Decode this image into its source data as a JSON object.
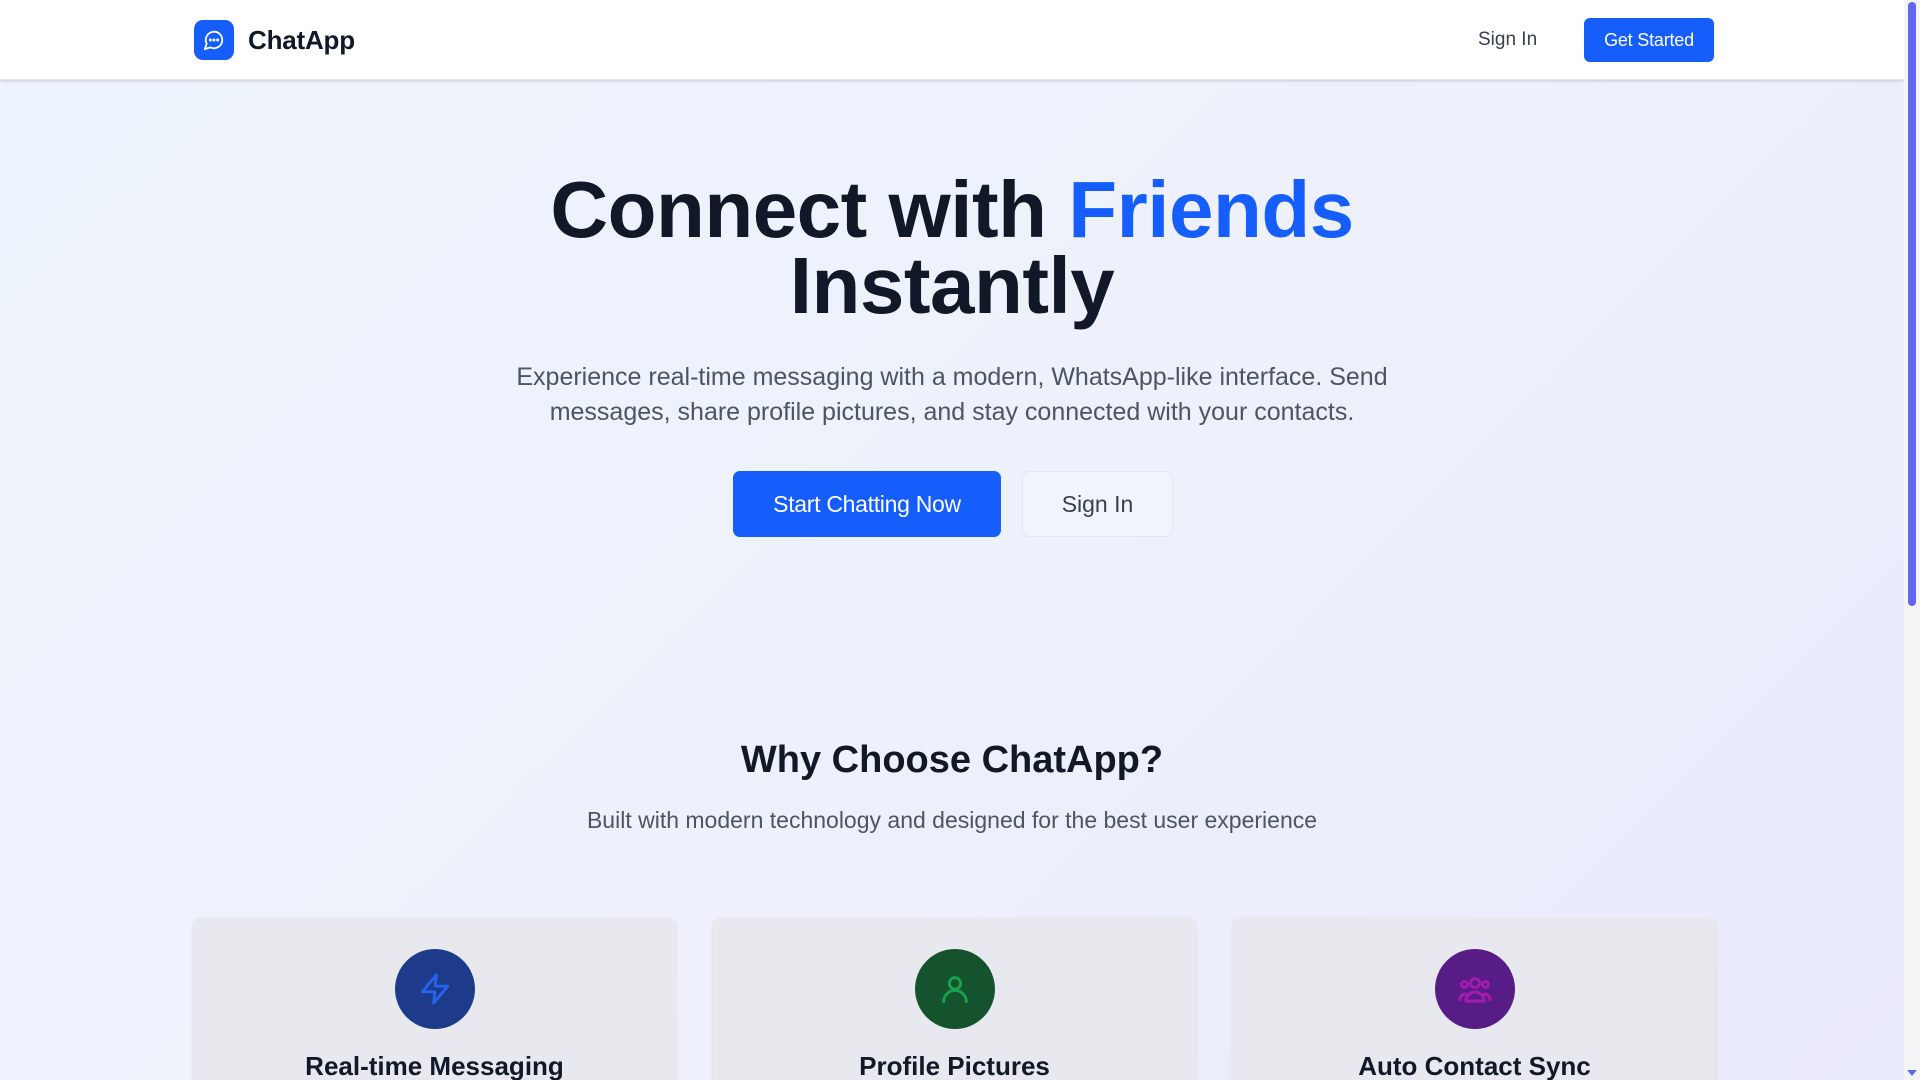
{
  "header": {
    "brand_name": "ChatApp",
    "sign_in_label": "Sign In",
    "get_started_label": "Get Started"
  },
  "hero": {
    "title_part1": "Connect with ",
    "title_accent": "Friends",
    "title_part2": "Instantly",
    "subtitle_line1": "Experience real-time messaging with a modern, WhatsApp-like interface. Send",
    "subtitle_line2": "messages, share profile pictures, and stay connected with your contacts.",
    "primary_cta": "Start Chatting Now",
    "secondary_cta": "Sign In"
  },
  "features": {
    "title": "Why Choose ChatApp?",
    "subtitle": "Built with modern technology and designed for the best user experience",
    "cards": [
      {
        "title": "Real-time Messaging",
        "icon": "lightning-icon",
        "icon_bg": "#1e3a8a",
        "icon_color": "#2563eb"
      },
      {
        "title": "Profile Pictures",
        "icon": "user-icon",
        "icon_bg": "#14532d",
        "icon_color": "#16a34a"
      },
      {
        "title": "Auto Contact Sync",
        "icon": "users-icon",
        "icon_bg": "#581c87",
        "icon_color": "#a21caf"
      }
    ]
  },
  "colors": {
    "accent": "#155efc",
    "heading": "#111827",
    "body_text": "#4b5563"
  }
}
